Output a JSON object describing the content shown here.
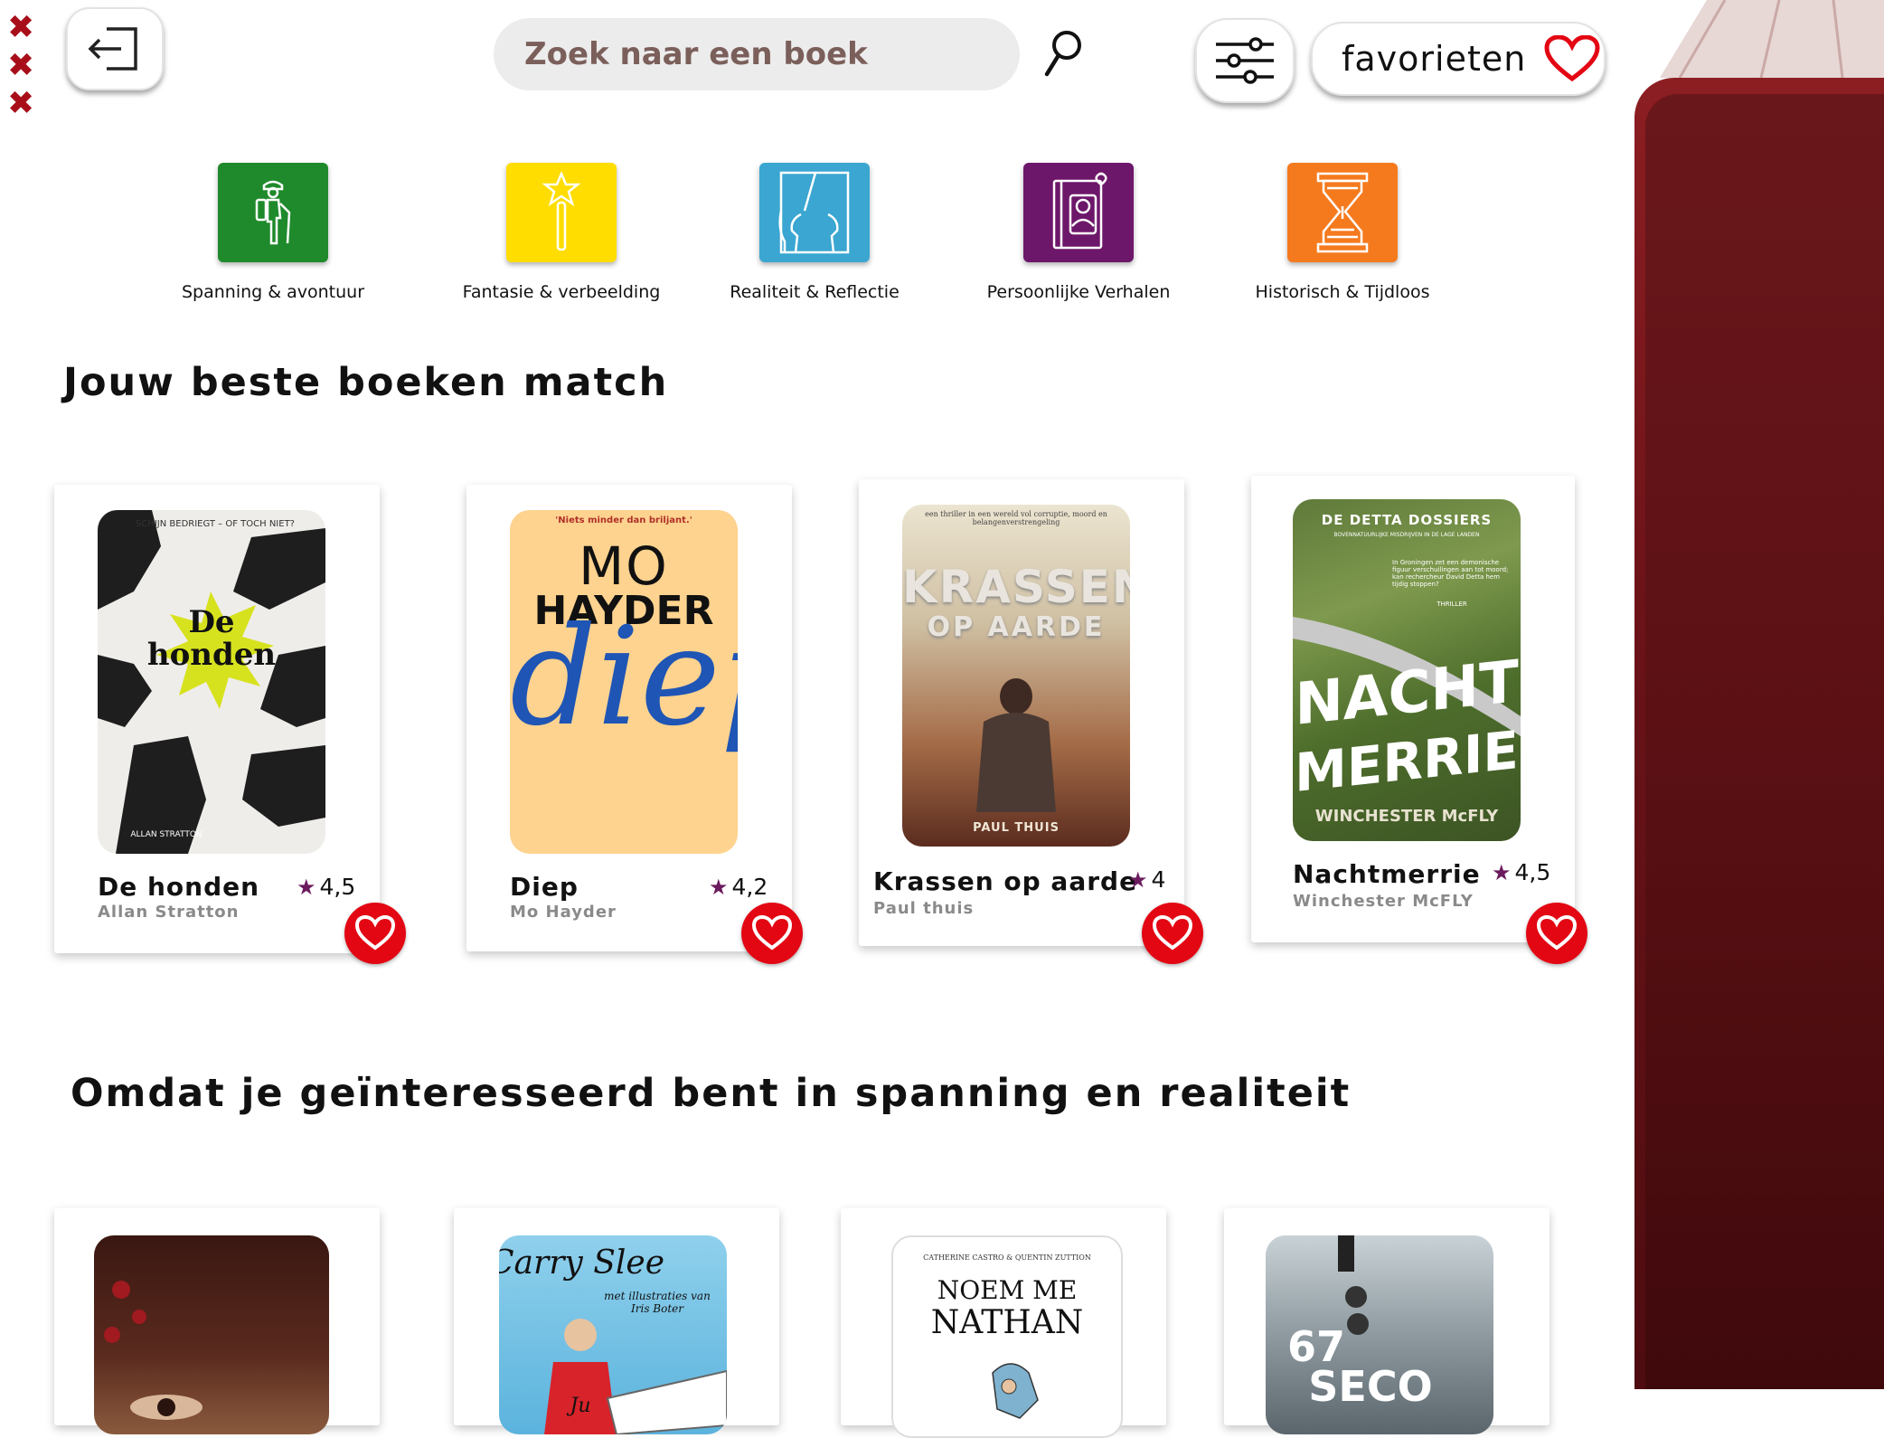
{
  "header": {
    "close_marks": [
      "✖",
      "✖",
      "✖"
    ],
    "search": {
      "placeholder": "Zoek naar een boek",
      "value": ""
    },
    "favorites_label": "favorieten"
  },
  "categories": [
    {
      "label": "Spanning & avontuur",
      "color": "#1f8a2b",
      "icon": "hiker-icon"
    },
    {
      "label": "Fantasie & verbeelding",
      "color": "#ffdd00",
      "icon": "magic-wand-icon"
    },
    {
      "label": "Realiteit & Reflectie",
      "color": "#3aa6d1",
      "icon": "mirror-faces-icon"
    },
    {
      "label": "Persoonlijke Verhalen",
      "color": "#6d176a",
      "icon": "diary-icon"
    },
    {
      "label": "Historisch & Tijdloos",
      "color": "#f57a1e",
      "icon": "hourglass-icon"
    }
  ],
  "sections": [
    {
      "title": "Jouw beste boeken match"
    },
    {
      "title": "Omdat je geïnteresseerd bent in spanning en realiteit"
    }
  ],
  "best_matches": [
    {
      "title": "De honden",
      "author": "Allan Stratton",
      "rating": "4,5",
      "cover": {
        "top_text": "SCHIJN BEDRIEGT – OF TOCH NIET?",
        "title_line1": "De",
        "title_line2": "honden",
        "author": "ALLAN STRATTON"
      }
    },
    {
      "title": "Diep",
      "author": "Mo Hayder",
      "rating": "4,2",
      "cover": {
        "quote": "'Niets minder dan briljant.'",
        "author_line1": "MO",
        "author_line2": "HAYDER",
        "title": "diep"
      }
    },
    {
      "title": "Krassen op aarde",
      "author": "Paul thuis",
      "rating": "4",
      "cover": {
        "tagline": "een thriller in een wereld vol corruptie, moord en belangenverstrengeling",
        "title_line1": "KRASSEN",
        "title_line2": "OP AARDE",
        "author": "PAUL THUIS"
      }
    },
    {
      "title": "Nachtmerrie",
      "author": "Winchester McFLY",
      "rating": "4,5",
      "cover": {
        "series": "DE DETTA DOSSIERS",
        "series_sub": "BOVENNATUURLIJKE MISDRIJVEN IN DE LAGE LANDEN",
        "blurb": "In Groningen zet een demonische figuur verschuilingen aan tot moord; kan rechercheur David Detta hem tijdig stoppen?",
        "genre": "THRILLER",
        "title_line1": "NACHT",
        "title_line2": "MERRIE",
        "author": "WINCHESTER McFLY"
      }
    }
  ],
  "interest_books": [
    {
      "cover": {}
    },
    {
      "cover": {
        "author": "Carry Slee",
        "illustrator": "met illustraties van Iris Boter",
        "boat_text": "Ju"
      }
    },
    {
      "cover": {
        "authors": "CATHERINE CASTRO & QUENTIN ZUTTION",
        "title_line1": "NOEM ME",
        "title_line2": "NATHAN"
      }
    },
    {
      "cover": {
        "title_line1": "67",
        "title_line2": "SECO"
      }
    }
  ],
  "colors": {
    "accent_red": "#e30613",
    "close_red": "#a80e1a",
    "rating_star": "#6b1b5e",
    "panel_red": "#6c1318"
  }
}
